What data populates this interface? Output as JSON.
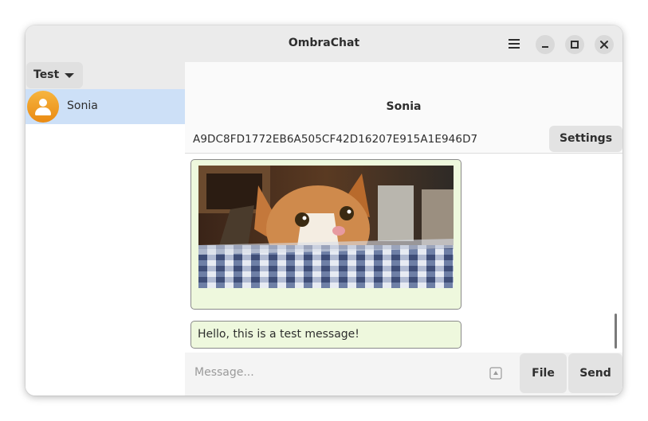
{
  "window": {
    "title": "OmbraChat"
  },
  "account": {
    "selected": "Test"
  },
  "sidebar": {
    "contacts": [
      {
        "name": "Sonia",
        "selected": true
      }
    ]
  },
  "chat": {
    "contact_name": "Sonia",
    "fingerprint": "A9DC8FD1772EB6A505CF42D16207E915A1E946D7",
    "settings_label": "Settings",
    "messages": [
      {
        "type": "image",
        "content": "cat-photo"
      },
      {
        "type": "text",
        "text": "Hello, this is a test message!"
      }
    ]
  },
  "composer": {
    "placeholder": "Message...",
    "value": "",
    "file_label": "File",
    "send_label": "Send"
  },
  "colors": {
    "selection": "#cde0f7",
    "bubble_bg": "#eef8dd",
    "avatar": "#f0a02a"
  }
}
